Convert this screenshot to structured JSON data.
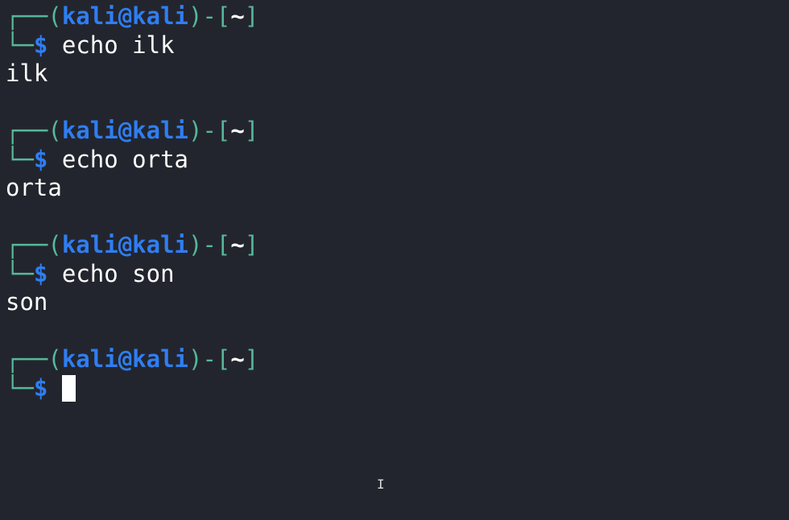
{
  "prompt": {
    "user": "kali",
    "at": "@",
    "host": "kali",
    "dir": "~",
    "symbol": "$"
  },
  "colors": {
    "background": "#23252e",
    "frame": "#55b89a",
    "prompt": "#2f7ef2",
    "text": "#ffffff"
  },
  "entries": [
    {
      "command": "echo ilk",
      "output": "ilk"
    },
    {
      "command": "echo orta",
      "output": "orta"
    },
    {
      "command": "echo son",
      "output": "son"
    }
  ],
  "current_input": ""
}
